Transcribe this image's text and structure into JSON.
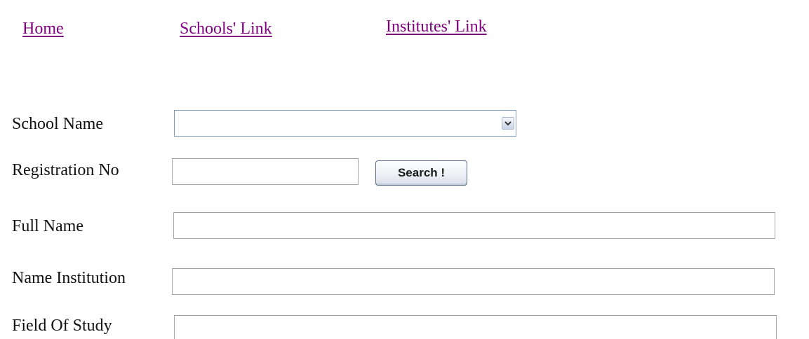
{
  "nav": {
    "home": "Home",
    "schools": "Schools' Link",
    "institutes": "Institutes' Link"
  },
  "form": {
    "school_name_label": "School Name",
    "school_name_value": "",
    "registration_label": "Registration No",
    "registration_value": "",
    "search_button": "Search !",
    "full_name_label": "Full Name",
    "full_name_value": "",
    "institution_label": "Name Institution",
    "institution_value": "",
    "field_of_study_label": "Field Of Study",
    "field_of_study_value": ""
  },
  "icons": {
    "dropdown": "chevron-down-icon"
  },
  "colors": {
    "link": "#800080",
    "select_border": "#7f9db9",
    "input_border": "#a9a9a9"
  }
}
